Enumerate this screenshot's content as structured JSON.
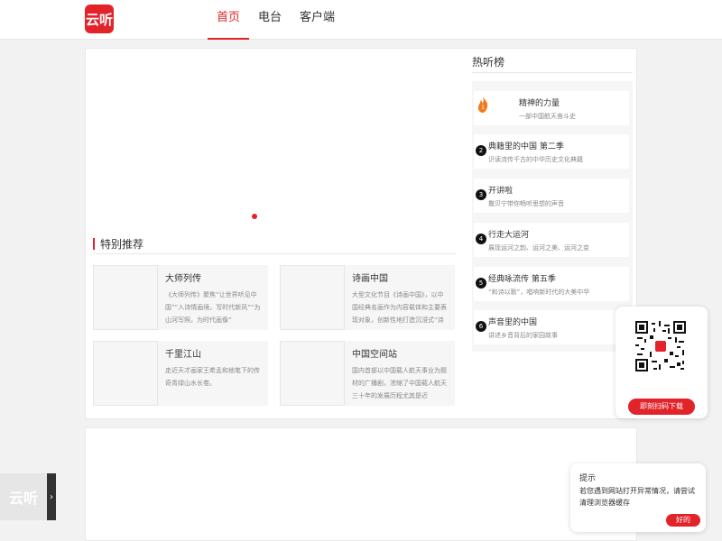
{
  "header": {
    "logo_text": "云听",
    "nav": [
      {
        "label": "首页"
      },
      {
        "label": "电台"
      },
      {
        "label": "客户端"
      }
    ]
  },
  "colors": {
    "accent": "#e2232a",
    "first_rank": "#f07a1e"
  },
  "section": {
    "title": "特别推荐"
  },
  "cards": [
    {
      "title": "大师列传",
      "desc": "《大师列传》聚焦“让世界听见中国”“入诗情画境，写时代新风”“为山河写照，为时代画像”"
    },
    {
      "title": "诗画中国",
      "desc": "大型文化节目《诗画中国》，以中国经典名画作为内容载体和主要表现对象，创新性地打造沉浸式“诗画”情境，通过人物创造"
    },
    {
      "title": "千里江山",
      "desc": "走近天才画家王希孟和他笔下的传奇青绿山水长卷。"
    },
    {
      "title": "中国空间站",
      "desc": "国内首部以中国载人航天事业为题材的广播剧，浓缩了中国载人航天三十年的发展历程尤其是近"
    }
  ],
  "hot": {
    "title": "热听榜",
    "items": [
      {
        "rank": "1",
        "name": "精神的力量",
        "sub": "一部中国航天奋斗史"
      },
      {
        "rank": "2",
        "name": "典籍里的中国 第二季",
        "sub": "识读流传千古的中华历史文化典籍"
      },
      {
        "rank": "3",
        "name": "开讲啦",
        "sub": "撒贝宁带你畅听思想的声音"
      },
      {
        "rank": "4",
        "name": "行走大运河",
        "sub": "展现运河之韵、运河之美、运河之变"
      },
      {
        "rank": "5",
        "name": "经典咏流传 第五季",
        "sub": "“和诗以歌”，唱响新时代的大美中华"
      },
      {
        "rank": "6",
        "name": "声音里的中国",
        "sub": "讲述乡音背后的家园故事"
      }
    ]
  },
  "qr": {
    "button_label": "即刻扫码下载"
  },
  "tip": {
    "title": "提示",
    "text": "若您遇到网站打开异常情况，请尝试清理浏览器缓存",
    "ok_label": "好的"
  },
  "side_tab": {
    "logo_text": "云听",
    "arrow": "›"
  }
}
